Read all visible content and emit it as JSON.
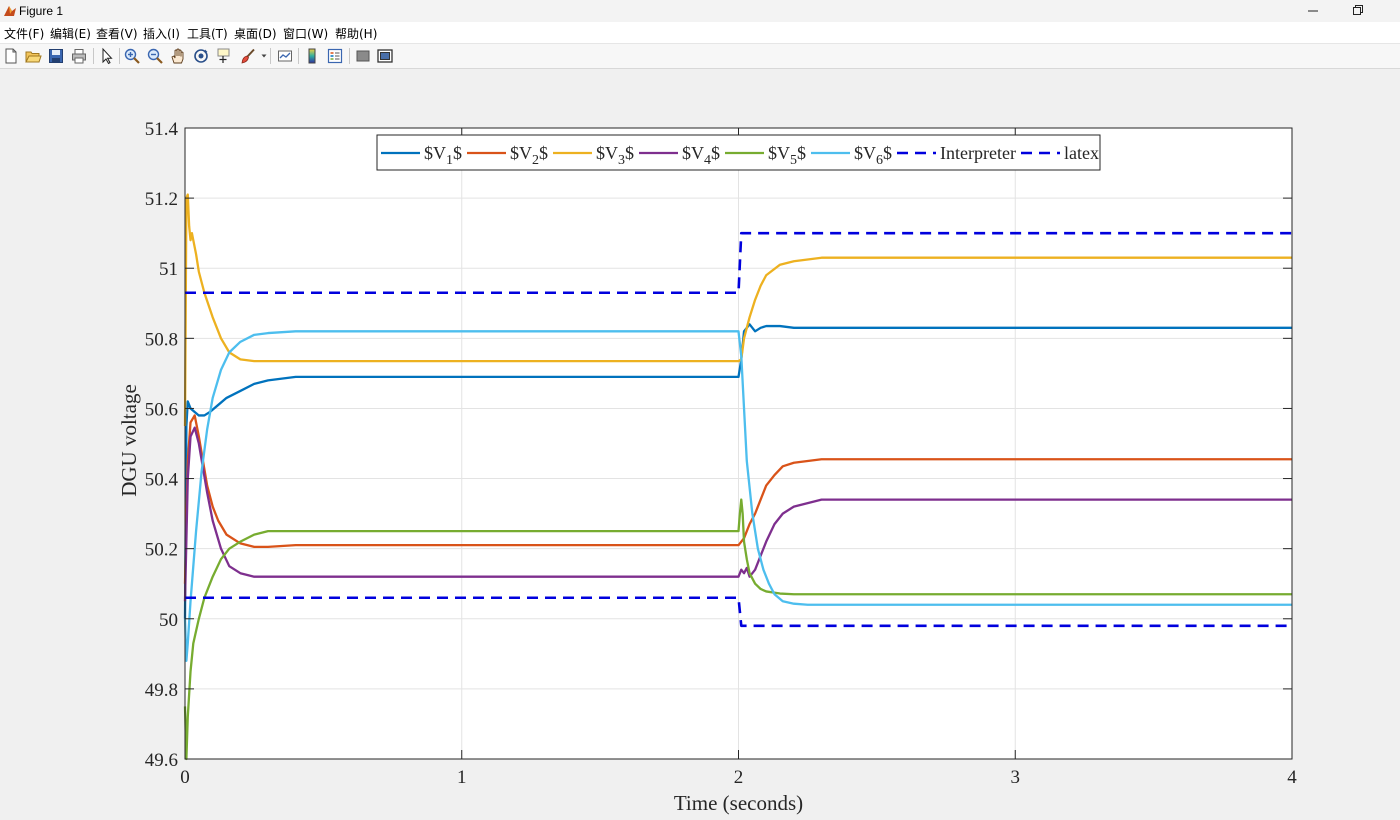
{
  "window": {
    "title": "Figure 1"
  },
  "menu": {
    "items": [
      "文件(F)",
      "编辑(E)",
      "查看(V)",
      "插入(I)",
      "工具(T)",
      "桌面(D)",
      "窗口(W)",
      "帮助(H)"
    ]
  },
  "toolbar": {
    "icons": [
      "new-figure-icon",
      "open-file-icon",
      "save-icon",
      "print-icon",
      "pointer-icon",
      "zoom-in-icon",
      "zoom-out-icon",
      "pan-icon",
      "rotate-3d-icon",
      "data-cursor-icon",
      "brush-icon",
      "link-plot-icon",
      "colorbar-icon",
      "legend-icon",
      "hide-plot-tools-icon",
      "show-plot-tools-icon"
    ]
  },
  "colors": {
    "V1": "#0072BD",
    "V2": "#D95319",
    "V3": "#EDB120",
    "V4": "#7E2F8E",
    "V5": "#77AC30",
    "V6": "#4DBEEE",
    "ref": "#0000DD"
  },
  "chart_data": {
    "type": "line",
    "title": "",
    "xlabel": "Time (seconds)",
    "ylabel": "DGU voltage",
    "xlim": [
      0,
      4
    ],
    "ylim": [
      49.6,
      51.4
    ],
    "xticks": [
      0,
      1,
      2,
      3,
      4
    ],
    "xtick_labels": [
      "0",
      "1",
      "2",
      "3",
      "4"
    ],
    "yticks": [
      49.6,
      49.8,
      50,
      50.2,
      50.4,
      50.6,
      50.8,
      51,
      51.2,
      51.4
    ],
    "ytick_labels": [
      "49.6",
      "49.8",
      "50",
      "50.2",
      "50.4",
      "50.6",
      "50.8",
      "51",
      "51.2",
      "51.4"
    ],
    "grid": true,
    "legend_position": "top-center",
    "series": [
      {
        "name": "$V_1$",
        "legend_base": "$V",
        "legend_sub": "1",
        "legend_tail": "$",
        "color": "#0072BD",
        "style": "solid",
        "x": [
          0,
          0.005,
          0.01,
          0.02,
          0.035,
          0.05,
          0.07,
          0.09,
          0.12,
          0.15,
          0.2,
          0.25,
          0.3,
          0.4,
          0.6,
          1.0,
          1.5,
          2.0,
          2.01,
          2.02,
          2.04,
          2.06,
          2.08,
          2.1,
          2.15,
          2.2,
          2.3,
          2.5,
          3.0,
          4.0
        ],
        "y": [
          50.0,
          50.55,
          50.62,
          50.6,
          50.59,
          50.58,
          50.58,
          50.59,
          50.61,
          50.63,
          50.65,
          50.67,
          50.68,
          50.69,
          50.69,
          50.69,
          50.69,
          50.69,
          50.74,
          50.82,
          50.84,
          50.82,
          50.83,
          50.835,
          50.835,
          50.83,
          50.83,
          50.83,
          50.83,
          50.83
        ]
      },
      {
        "name": "$V_2$",
        "legend_base": "$V",
        "legend_sub": "2",
        "legend_tail": "$",
        "color": "#D95319",
        "style": "solid",
        "x": [
          0,
          0.01,
          0.02,
          0.035,
          0.05,
          0.065,
          0.08,
          0.1,
          0.12,
          0.15,
          0.2,
          0.25,
          0.3,
          0.4,
          0.6,
          1.0,
          1.5,
          2.0,
          2.02,
          2.04,
          2.06,
          2.08,
          2.1,
          2.13,
          2.16,
          2.2,
          2.25,
          2.3,
          2.4,
          2.6,
          3.0,
          4.0
        ],
        "y": [
          50.1,
          50.45,
          50.56,
          50.58,
          50.52,
          50.45,
          50.38,
          50.32,
          50.28,
          50.24,
          50.215,
          50.205,
          50.205,
          50.21,
          50.21,
          50.21,
          50.21,
          50.21,
          50.23,
          50.27,
          50.3,
          50.34,
          50.38,
          50.41,
          50.435,
          50.445,
          50.45,
          50.455,
          50.455,
          50.455,
          50.455,
          50.455
        ]
      },
      {
        "name": "$V_3$",
        "legend_base": "$V",
        "legend_sub": "3",
        "legend_tail": "$",
        "color": "#EDB120",
        "style": "solid",
        "x": [
          0,
          0.005,
          0.01,
          0.015,
          0.02,
          0.025,
          0.03,
          0.04,
          0.05,
          0.07,
          0.1,
          0.13,
          0.16,
          0.2,
          0.25,
          0.3,
          0.4,
          0.6,
          1.0,
          1.5,
          2.0,
          2.01,
          2.02,
          2.04,
          2.06,
          2.08,
          2.1,
          2.15,
          2.2,
          2.3,
          2.5,
          3.0,
          4.0
        ],
        "y": [
          50.55,
          51.2,
          51.21,
          51.12,
          51.08,
          51.1,
          51.08,
          51.04,
          50.99,
          50.93,
          50.86,
          50.8,
          50.76,
          50.74,
          50.735,
          50.735,
          50.735,
          50.735,
          50.735,
          50.735,
          50.735,
          50.74,
          50.8,
          50.86,
          50.91,
          50.95,
          50.98,
          51.01,
          51.02,
          51.03,
          51.03,
          51.03,
          51.03
        ]
      },
      {
        "name": "$V_4$",
        "legend_base": "$V",
        "legend_sub": "4",
        "legend_tail": "$",
        "color": "#7E2F8E",
        "style": "solid",
        "x": [
          0,
          0.01,
          0.02,
          0.035,
          0.05,
          0.065,
          0.08,
          0.1,
          0.13,
          0.16,
          0.2,
          0.25,
          0.3,
          0.4,
          0.6,
          1.0,
          1.5,
          2.0,
          2.01,
          2.02,
          2.03,
          2.04,
          2.06,
          2.08,
          2.1,
          2.13,
          2.16,
          2.2,
          2.25,
          2.3,
          2.4,
          2.6,
          3.0,
          4.0
        ],
        "y": [
          50.05,
          50.4,
          50.52,
          50.545,
          50.5,
          50.43,
          50.36,
          50.28,
          50.2,
          50.15,
          50.13,
          50.12,
          50.12,
          50.12,
          50.12,
          50.12,
          50.12,
          50.12,
          50.14,
          50.13,
          50.145,
          50.12,
          50.14,
          50.18,
          50.22,
          50.27,
          50.3,
          50.32,
          50.33,
          50.34,
          50.34,
          50.34,
          50.34,
          50.34
        ]
      },
      {
        "name": "$V_5$",
        "legend_base": "$V",
        "legend_sub": "5",
        "legend_tail": "$",
        "color": "#77AC30",
        "style": "solid",
        "x": [
          0,
          0.005,
          0.01,
          0.02,
          0.03,
          0.05,
          0.07,
          0.1,
          0.13,
          0.16,
          0.2,
          0.25,
          0.3,
          0.4,
          0.6,
          1.0,
          1.5,
          2.0,
          2.005,
          2.01,
          2.015,
          2.02,
          2.03,
          2.04,
          2.06,
          2.08,
          2.1,
          2.15,
          2.2,
          2.3,
          2.5,
          3.0,
          4.0
        ],
        "y": [
          49.75,
          49.6,
          49.72,
          49.85,
          49.93,
          50.0,
          50.06,
          50.12,
          50.17,
          50.2,
          50.22,
          50.24,
          50.25,
          50.25,
          50.25,
          50.25,
          50.25,
          50.25,
          50.3,
          50.34,
          50.3,
          50.22,
          50.17,
          50.13,
          50.1,
          50.085,
          50.078,
          50.072,
          50.07,
          50.07,
          50.07,
          50.07,
          50.07
        ]
      },
      {
        "name": "$V_6$",
        "legend_base": "$V",
        "legend_sub": "6",
        "legend_tail": "$",
        "color": "#4DBEEE",
        "style": "solid",
        "x": [
          0,
          0.005,
          0.01,
          0.02,
          0.04,
          0.06,
          0.08,
          0.1,
          0.13,
          0.16,
          0.2,
          0.25,
          0.3,
          0.4,
          0.6,
          1.0,
          1.5,
          2.0,
          2.01,
          2.02,
          2.03,
          2.05,
          2.07,
          2.09,
          2.11,
          2.13,
          2.16,
          2.2,
          2.25,
          2.3,
          2.4,
          2.6,
          3.0,
          4.0
        ],
        "y": [
          50.0,
          49.88,
          49.93,
          50.05,
          50.25,
          50.42,
          50.54,
          50.63,
          50.71,
          50.76,
          50.79,
          50.81,
          50.815,
          50.82,
          50.82,
          50.82,
          50.82,
          50.82,
          50.75,
          50.6,
          50.45,
          50.3,
          50.2,
          50.14,
          50.1,
          50.07,
          50.05,
          50.043,
          50.04,
          50.04,
          50.04,
          50.04,
          50.04,
          50.04
        ]
      },
      {
        "name": "Interpreter",
        "legend_base": "Interpreter",
        "legend_sub": "",
        "legend_tail": "",
        "color": "#0000DD",
        "style": "dashed",
        "x": [
          0,
          2.0,
          2.01,
          4.0
        ],
        "y": [
          50.93,
          50.93,
          51.1,
          51.1
        ]
      },
      {
        "name": "latex",
        "legend_base": "latex",
        "legend_sub": "",
        "legend_tail": "",
        "color": "#0000DD",
        "style": "dashed",
        "x": [
          0,
          2.0,
          2.01,
          4.0
        ],
        "y": [
          50.06,
          50.06,
          49.98,
          49.98
        ]
      }
    ]
  }
}
